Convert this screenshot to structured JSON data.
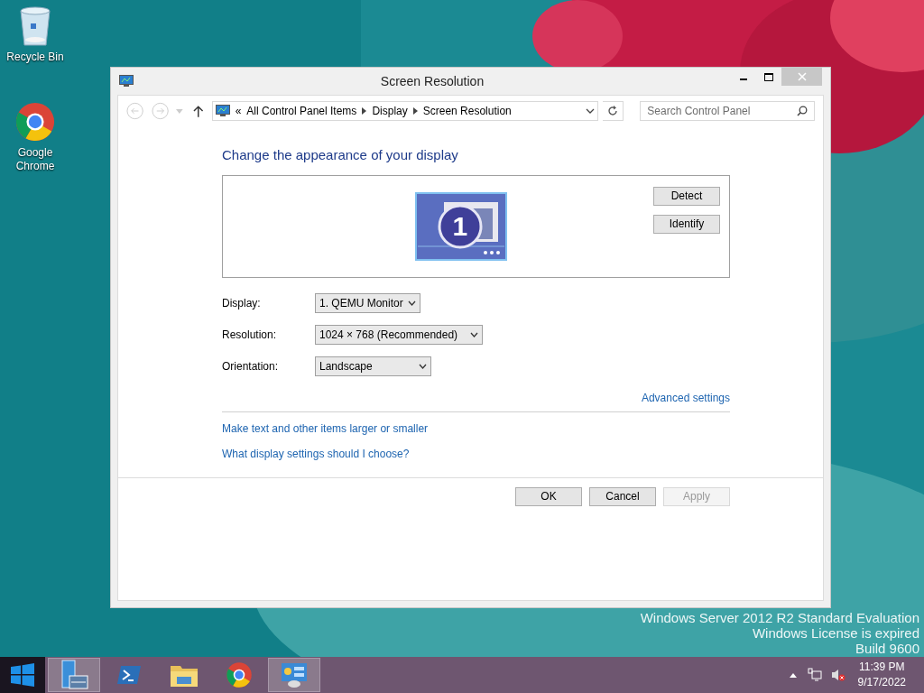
{
  "desktop_icons": [
    {
      "kind": "recycle",
      "label": "Recycle Bin"
    },
    {
      "kind": "chrome",
      "label": "Google Chrome"
    }
  ],
  "window": {
    "title": "Screen Resolution",
    "breadcrumb": {
      "prefix": "«",
      "items": [
        "All Control Panel Items",
        "Display",
        "Screen Resolution"
      ]
    },
    "search": {
      "placeholder": "Search Control Panel"
    },
    "heading": "Change the appearance of your display",
    "monitor_number": "1",
    "side_buttons": [
      "Detect",
      "Identify"
    ],
    "settings": [
      {
        "label": "Display:",
        "value": "1. QEMU Monitor"
      },
      {
        "label": "Resolution:",
        "value": "1024 × 768 (Recommended)"
      },
      {
        "label": "Orientation:",
        "value": "Landscape"
      }
    ],
    "advanced_link": "Advanced settings",
    "links": [
      "Make text and other items larger or smaller",
      "What display settings should I choose?"
    ],
    "buttons": [
      {
        "label": "OK",
        "disabled": false
      },
      {
        "label": "Cancel",
        "disabled": false
      },
      {
        "label": "Apply",
        "disabled": true
      }
    ]
  },
  "watermark_lines": [
    "Windows Server 2012 R2 Standard Evaluation",
    "Windows License is expired",
    "Build 9600"
  ],
  "taskbar": {
    "items": [
      {
        "kind": "server",
        "active": true
      },
      {
        "kind": "powershell",
        "active": false
      },
      {
        "kind": "folder",
        "active": false
      },
      {
        "kind": "chrome",
        "active": false
      },
      {
        "kind": "control",
        "active": true
      }
    ],
    "time": "11:39 PM",
    "date": "9/17/2022"
  }
}
